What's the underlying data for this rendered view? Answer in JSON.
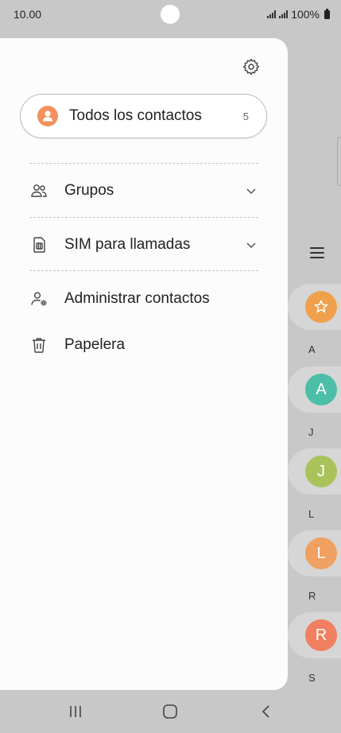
{
  "status": {
    "time": "10.00",
    "battery": "100%"
  },
  "drawer": {
    "all_contacts": {
      "label": "Todos los contactos",
      "count": "5"
    },
    "items": [
      {
        "label": "Grupos",
        "icon": "people-icon"
      },
      {
        "label": "SIM para llamadas",
        "icon": "sim-card-icon"
      },
      {
        "label": "Administrar contactos",
        "icon": "manage-contacts-icon"
      },
      {
        "label": "Papelera",
        "icon": "trash-icon"
      }
    ]
  },
  "background_list": {
    "index_letters": [
      "A",
      "J",
      "L",
      "R",
      "S"
    ],
    "avatars": [
      {
        "initial": "",
        "color": "#f0a04b",
        "type": "favorites"
      },
      {
        "initial": "A",
        "color": "#4dbfa8"
      },
      {
        "initial": "J",
        "color": "#a9c35a"
      },
      {
        "initial": "L",
        "color": "#f0a060"
      },
      {
        "initial": "R",
        "color": "#f08060"
      }
    ]
  },
  "colors": {
    "accent_avatar": "#f0915e"
  }
}
